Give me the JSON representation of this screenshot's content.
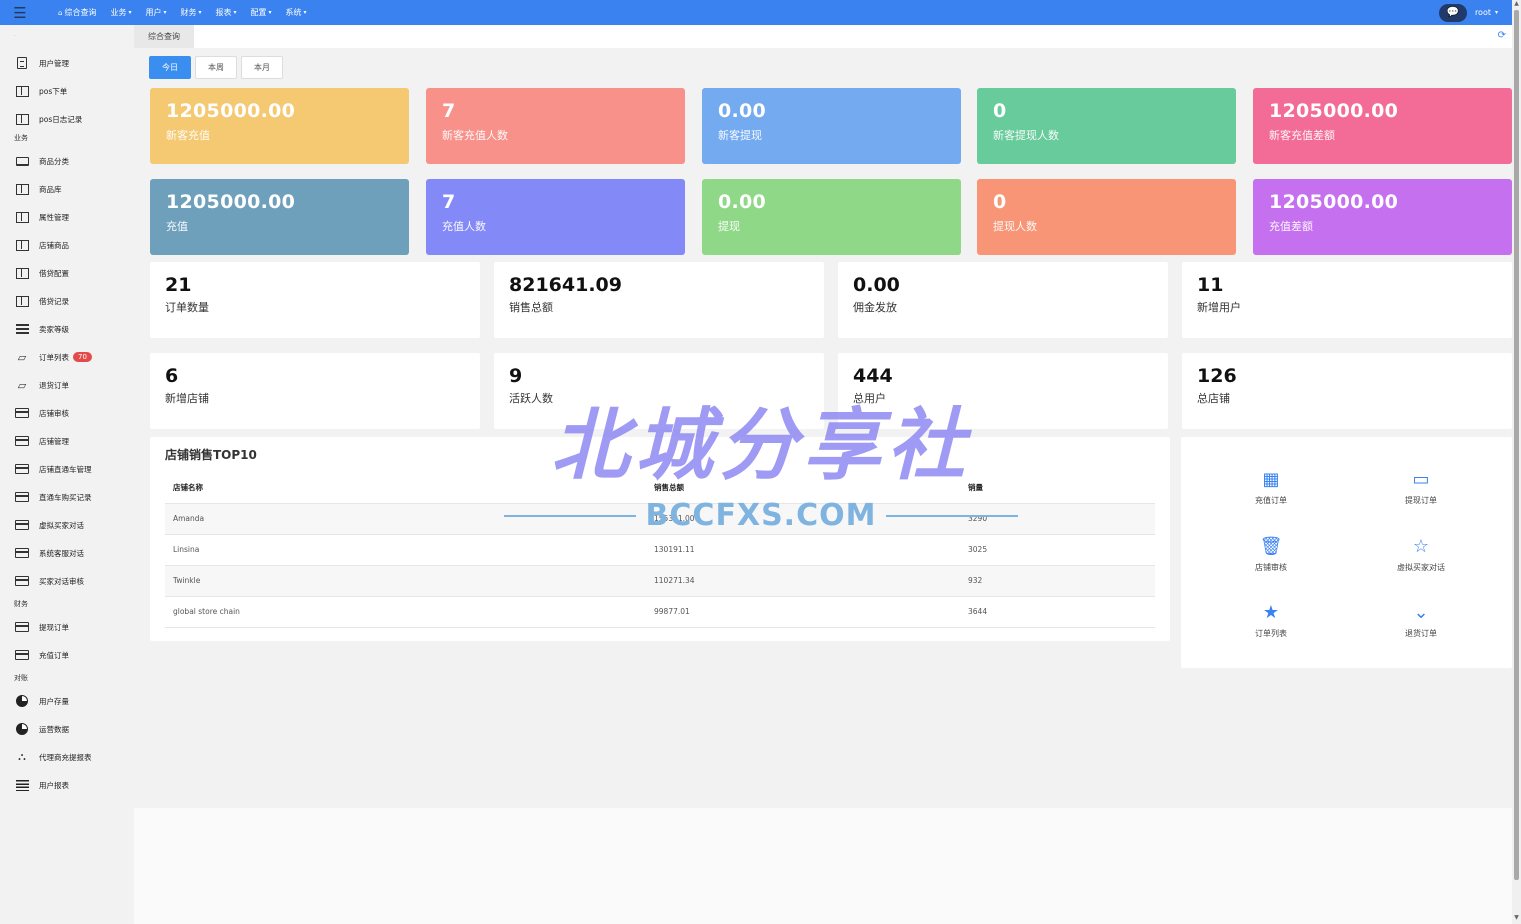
{
  "topbar": {
    "nav": [
      {
        "label": "综合查询",
        "has_caret": false
      },
      {
        "label": "业务",
        "has_caret": true
      },
      {
        "label": "用户",
        "has_caret": true
      },
      {
        "label": "财务",
        "has_caret": true
      },
      {
        "label": "报表",
        "has_caret": true
      },
      {
        "label": "配置",
        "has_caret": true
      },
      {
        "label": "系统",
        "has_caret": true
      }
    ],
    "user": "root",
    "accent": "#3a82f0"
  },
  "sidebar": {
    "items_a": [
      {
        "label": "用户管理",
        "icon": "document-icon"
      },
      {
        "label": "pos下单",
        "icon": "columns-icon"
      },
      {
        "label": "pos日志记录",
        "icon": "columns-icon"
      }
    ],
    "group_business": "业务",
    "items_b": [
      {
        "label": "商品分类",
        "icon": "laptop-icon"
      },
      {
        "label": "商品库",
        "icon": "columns-icon"
      },
      {
        "label": "属性管理",
        "icon": "columns-icon"
      },
      {
        "label": "店铺商品",
        "icon": "columns-icon"
      },
      {
        "label": "借贷配置",
        "icon": "columns-icon"
      },
      {
        "label": "借贷记录",
        "icon": "columns-icon"
      },
      {
        "label": "卖家等级",
        "icon": "list-icon"
      },
      {
        "label": "订单列表",
        "icon": "pencil-icon",
        "badge": "70"
      },
      {
        "label": "退货订单",
        "icon": "pencil-icon"
      },
      {
        "label": "店铺审核",
        "icon": "card-icon"
      },
      {
        "label": "店铺管理",
        "icon": "card-icon"
      },
      {
        "label": "店铺直通车管理",
        "icon": "card-icon"
      },
      {
        "label": "直通车购买记录",
        "icon": "card-icon"
      },
      {
        "label": "虚拟买家对话",
        "icon": "card-icon"
      },
      {
        "label": "系统客服对话",
        "icon": "card-icon"
      },
      {
        "label": "买家对话审核",
        "icon": "card-icon"
      }
    ],
    "group_finance": "财务",
    "items_c": [
      {
        "label": "提现订单",
        "icon": "card-icon"
      },
      {
        "label": "充值订单",
        "icon": "card-icon"
      }
    ],
    "group_report": "对账",
    "items_d": [
      {
        "label": "用户存量",
        "icon": "pie-icon"
      },
      {
        "label": "运营数据",
        "icon": "pie-icon"
      },
      {
        "label": "代理商充提报表",
        "icon": "org-icon"
      },
      {
        "label": "用户报表",
        "icon": "lines-icon"
      }
    ]
  },
  "tabbar": {
    "active_tab": "综合查询"
  },
  "range_tabs": [
    "今日",
    "本周",
    "本月"
  ],
  "tiles_row1": [
    {
      "value": "1205000.00",
      "label": "新客充值",
      "color": "#f5c872"
    },
    {
      "value": "7",
      "label": "新客充值人数",
      "color": "#f7918a"
    },
    {
      "value": "0.00",
      "label": "新客提现",
      "color": "#73aaf0"
    },
    {
      "value": "0",
      "label": "新客提现人数",
      "color": "#67cb9b"
    },
    {
      "value": "1205000.00",
      "label": "新客充值差额",
      "color": "#f36c97"
    }
  ],
  "tiles_row2": [
    {
      "value": "1205000.00",
      "label": "充值",
      "color": "#6e9fbb"
    },
    {
      "value": "7",
      "label": "充值人数",
      "color": "#8389f7"
    },
    {
      "value": "0.00",
      "label": "提现",
      "color": "#8ed887"
    },
    {
      "value": "0",
      "label": "提现人数",
      "color": "#f79576"
    },
    {
      "value": "1205000.00",
      "label": "充值差额",
      "color": "#c570ef"
    }
  ],
  "stats_row1": [
    {
      "value": "21",
      "label": "订单数量"
    },
    {
      "value": "821641.09",
      "label": "销售总额"
    },
    {
      "value": "0.00",
      "label": "佣金发放"
    },
    {
      "value": "11",
      "label": "新增用户"
    }
  ],
  "stats_row2": [
    {
      "value": "6",
      "label": "新增店铺"
    },
    {
      "value": "9",
      "label": "活跃人数"
    },
    {
      "value": "444",
      "label": "总用户"
    },
    {
      "value": "126",
      "label": "总店铺"
    }
  ],
  "top10": {
    "title": "店铺销售TOP10",
    "columns": [
      "店铺名称",
      "销售总额",
      "销量"
    ],
    "rows": [
      [
        "Amanda",
        "155301.00",
        "3290"
      ],
      [
        "Linsina",
        "130191.11",
        "3025"
      ],
      [
        "Twinkle",
        "110271.34",
        "932"
      ],
      [
        "global store chain",
        "99877.01",
        "3644"
      ]
    ]
  },
  "quick_links": [
    {
      "label": "充值订单",
      "icon": "qrcode-icon"
    },
    {
      "label": "提现订单",
      "icon": "card-icon"
    },
    {
      "label": "店铺审核",
      "icon": "trash-icon"
    },
    {
      "label": "虚拟买家对话",
      "icon": "star-outline-icon"
    },
    {
      "label": "订单列表",
      "icon": "star-icon"
    },
    {
      "label": "退货订单",
      "icon": "chevron-down-icon"
    }
  ],
  "watermark": {
    "main": "北城分享社",
    "sub": "BCCFXS.COM"
  }
}
